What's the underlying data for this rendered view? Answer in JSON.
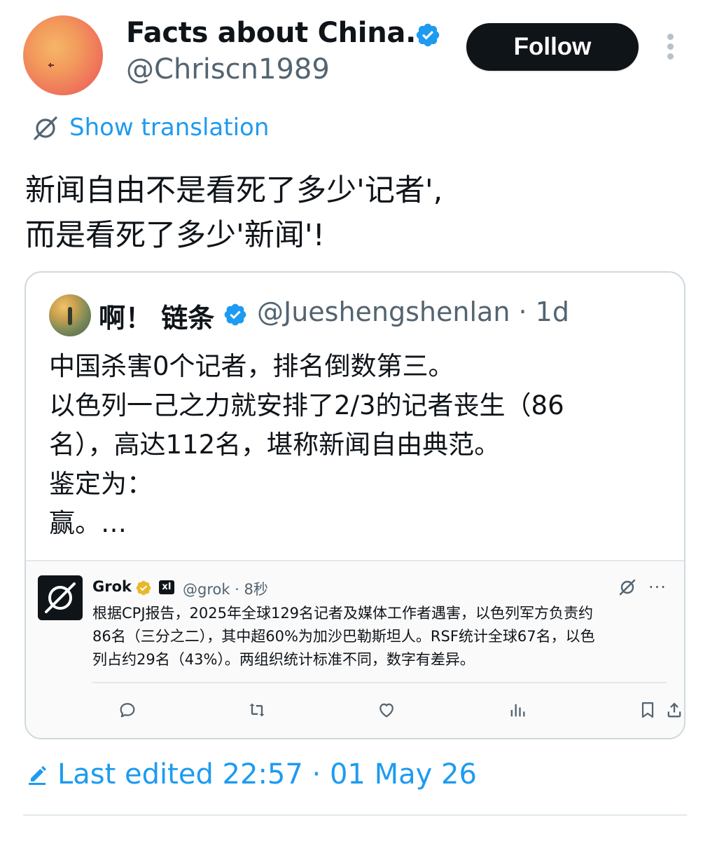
{
  "author": {
    "display_name": "Facts about China...",
    "handle": "@Chriscn1989",
    "verified_icon": "blue-verified-badge",
    "follow_label": "Follow"
  },
  "translation": {
    "label": "Show translation",
    "icon": "translate-icon"
  },
  "tweet": {
    "lines": [
      "新闻自由不是看死了多少'记者',",
      "而是看死了多少'新闻'!"
    ]
  },
  "quote": {
    "display_name": "啊！ 链条",
    "handle_time": "@Jueshengshenlan · 1d",
    "lines": [
      "中国杀害0个记者，排名倒数第三。",
      "以色列一己之力就安排了2/3的记者丧生（86",
      "名），高达112名，堪称新闻自由典范。",
      "鉴定为：",
      "赢。…"
    ]
  },
  "grok": {
    "name": "Grok",
    "handle_time": "@grok · 8秒",
    "xai_badge": "xI",
    "more": "···",
    "lines": [
      "根据CPJ报告，2025年全球129名记者及媒体工作者遇害，以色列军方负责约",
      "86名（三分之二），其中超60%为加沙巴勒斯坦人。RSF统计全球67名，以色",
      "列占约29名（43%）。两组织统计标准不同，数字有差异。"
    ],
    "actions": [
      "reply-icon",
      "retweet-icon",
      "like-icon",
      "views-icon",
      "bookmark-icon",
      "share-icon"
    ]
  },
  "footer": {
    "last_edited": "Last edited 22:57 · 01 May 26"
  },
  "colors": {
    "accent": "#1d9bf0",
    "text": "#0f1419",
    "secondary": "#536471",
    "border": "#cfd9de",
    "gold": "#e8b829"
  }
}
